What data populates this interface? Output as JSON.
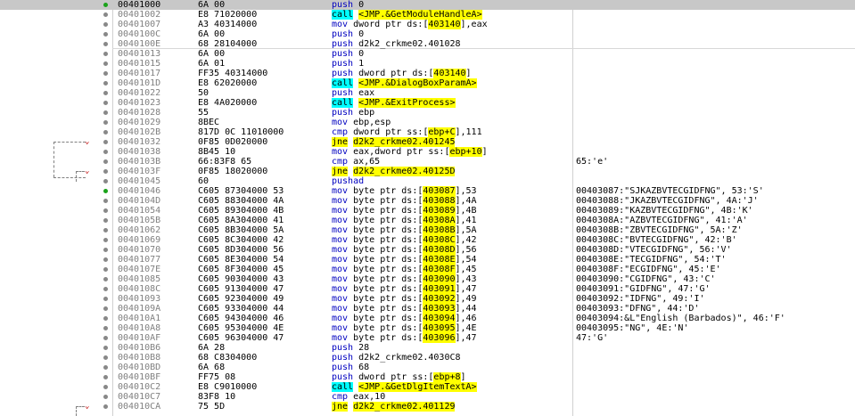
{
  "rows": [
    {
      "addr": "00401000",
      "bytes": "6A 00",
      "mnem": "push",
      "ops": "0",
      "opkind": "num",
      "comment": "",
      "sel": true,
      "bp": true
    },
    {
      "addr": "00401002",
      "bytes": "E8 71020000",
      "mnem": "call",
      "ops": "<JMP.&GetModuleHandleA>",
      "opkind": "call",
      "comment": ""
    },
    {
      "addr": "00401007",
      "bytes": "A3 40314000",
      "mnem": "mov",
      "ops": "dword ptr ds:[403140],eax",
      "opkind": "mem",
      "hl": "403140",
      "comment": ""
    },
    {
      "addr": "0040100C",
      "bytes": "6A 00",
      "mnem": "push",
      "ops": "0",
      "opkind": "num",
      "comment": ""
    },
    {
      "addr": "0040100E",
      "bytes": "68 28104000",
      "mnem": "push",
      "ops": "d2k2_crkme02.401028",
      "opkind": "plain",
      "comment": ""
    },
    {
      "addr": "00401013",
      "bytes": "6A 00",
      "mnem": "push",
      "ops": "0",
      "opkind": "num",
      "comment": ""
    },
    {
      "addr": "00401015",
      "bytes": "6A 01",
      "mnem": "push",
      "ops": "1",
      "opkind": "num",
      "comment": ""
    },
    {
      "addr": "00401017",
      "bytes": "FF35 40314000",
      "mnem": "push",
      "ops": "dword ptr ds:[403140]",
      "opkind": "mem",
      "hl": "403140",
      "comment": ""
    },
    {
      "addr": "0040101D",
      "bytes": "E8 62020000",
      "mnem": "call",
      "ops": "<JMP.&DialogBoxParamA>",
      "opkind": "call",
      "comment": ""
    },
    {
      "addr": "00401022",
      "bytes": "50",
      "mnem": "push",
      "ops": "eax",
      "opkind": "plain",
      "comment": ""
    },
    {
      "addr": "00401023",
      "bytes": "E8 4A020000",
      "mnem": "call",
      "ops": "<JMP.&ExitProcess>",
      "opkind": "call",
      "comment": ""
    },
    {
      "addr": "00401028",
      "bytes": "55",
      "mnem": "push",
      "ops": "ebp",
      "opkind": "plain",
      "comment": ""
    },
    {
      "addr": "00401029",
      "bytes": "8BEC",
      "mnem": "mov",
      "ops": "ebp,esp",
      "opkind": "plain",
      "comment": ""
    },
    {
      "addr": "0040102B",
      "bytes": "817D 0C 11010000",
      "mnem": "cmp",
      "ops": "dword ptr ss:[ebp+C],111",
      "opkind": "mem",
      "hl": "ebp+C",
      "comment": ""
    },
    {
      "addr": "00401032",
      "bytes": "0F85 0D020000",
      "mnem": "jne",
      "ops": "d2k2_crkme02.401245",
      "opkind": "jmp",
      "comment": "",
      "arrow": true
    },
    {
      "addr": "00401038",
      "bytes": "8B45 10",
      "mnem": "mov",
      "ops": "eax,dword ptr ss:[ebp+10]",
      "opkind": "mem",
      "hl": "ebp+10",
      "comment": ""
    },
    {
      "addr": "0040103B",
      "bytes": "66:83F8 65",
      "mnem": "cmp",
      "ops": "ax,65",
      "opkind": "plain",
      "comment": "65:'e'"
    },
    {
      "addr": "0040103F",
      "bytes": "0F85 18020000",
      "mnem": "jne",
      "ops": "d2k2_crkme02.40125D",
      "opkind": "jmp",
      "comment": "",
      "arrow": true
    },
    {
      "addr": "00401045",
      "bytes": "60",
      "mnem": "pushad",
      "ops": "",
      "opkind": "plain",
      "comment": ""
    },
    {
      "addr": "00401046",
      "bytes": "C605 87304000 53",
      "mnem": "mov",
      "ops": "byte ptr ds:[403087],53",
      "opkind": "mem",
      "hl": "403087",
      "comment": "00403087:\"SJKAZBVTECGIDFNG\", 53:'S'",
      "bp": true
    },
    {
      "addr": "0040104D",
      "bytes": "C605 88304000 4A",
      "mnem": "mov",
      "ops": "byte ptr ds:[403088],4A",
      "opkind": "mem",
      "hl": "403088",
      "comment": "00403088:\"JKAZBVTECGIDFNG\", 4A:'J'"
    },
    {
      "addr": "00401054",
      "bytes": "C605 89304000 4B",
      "mnem": "mov",
      "ops": "byte ptr ds:[403089],4B",
      "opkind": "mem",
      "hl": "403089",
      "comment": "00403089:\"KAZBVTECGIDFNG\", 4B:'K'"
    },
    {
      "addr": "0040105B",
      "bytes": "C605 8A304000 41",
      "mnem": "mov",
      "ops": "byte ptr ds:[40308A],41",
      "opkind": "mem",
      "hl": "40308A",
      "comment": "0040308A:\"AZBVTECGIDFNG\", 41:'A'"
    },
    {
      "addr": "00401062",
      "bytes": "C605 8B304000 5A",
      "mnem": "mov",
      "ops": "byte ptr ds:[40308B],5A",
      "opkind": "mem",
      "hl": "40308B",
      "comment": "0040308B:\"ZBVTECGIDFNG\", 5A:'Z'"
    },
    {
      "addr": "00401069",
      "bytes": "C605 8C304000 42",
      "mnem": "mov",
      "ops": "byte ptr ds:[40308C],42",
      "opkind": "mem",
      "hl": "40308C",
      "comment": "0040308C:\"BVTECGIDFNG\", 42:'B'"
    },
    {
      "addr": "00401070",
      "bytes": "C605 8D304000 56",
      "mnem": "mov",
      "ops": "byte ptr ds:[40308D],56",
      "opkind": "mem",
      "hl": "40308D",
      "comment": "0040308D:\"VTECGIDFNG\", 56:'V'"
    },
    {
      "addr": "00401077",
      "bytes": "C605 8E304000 54",
      "mnem": "mov",
      "ops": "byte ptr ds:[40308E],54",
      "opkind": "mem",
      "hl": "40308E",
      "comment": "0040308E:\"TECGIDFNG\", 54:'T'"
    },
    {
      "addr": "0040107E",
      "bytes": "C605 8F304000 45",
      "mnem": "mov",
      "ops": "byte ptr ds:[40308F],45",
      "opkind": "mem",
      "hl": "40308F",
      "comment": "0040308F:\"ECGIDFNG\", 45:'E'"
    },
    {
      "addr": "00401085",
      "bytes": "C605 90304000 43",
      "mnem": "mov",
      "ops": "byte ptr ds:[403090],43",
      "opkind": "mem",
      "hl": "403090",
      "comment": "00403090:\"CGIDFNG\", 43:'C'"
    },
    {
      "addr": "0040108C",
      "bytes": "C605 91304000 47",
      "mnem": "mov",
      "ops": "byte ptr ds:[403091],47",
      "opkind": "mem",
      "hl": "403091",
      "comment": "00403091:\"GIDFNG\", 47:'G'"
    },
    {
      "addr": "00401093",
      "bytes": "C605 92304000 49",
      "mnem": "mov",
      "ops": "byte ptr ds:[403092],49",
      "opkind": "mem",
      "hl": "403092",
      "comment": "00403092:\"IDFNG\", 49:'I'"
    },
    {
      "addr": "0040109A",
      "bytes": "C605 93304000 44",
      "mnem": "mov",
      "ops": "byte ptr ds:[403093],44",
      "opkind": "mem",
      "hl": "403093",
      "comment": "00403093:\"DFNG\", 44:'D'"
    },
    {
      "addr": "004010A1",
      "bytes": "C605 94304000 46",
      "mnem": "mov",
      "ops": "byte ptr ds:[403094],46",
      "opkind": "mem",
      "hl": "403094",
      "comment": "00403094:&L\"English (Barbados)\", 46:'F'"
    },
    {
      "addr": "004010A8",
      "bytes": "C605 95304000 4E",
      "mnem": "mov",
      "ops": "byte ptr ds:[403095],4E",
      "opkind": "mem",
      "hl": "403095",
      "comment": "00403095:\"NG\", 4E:'N'"
    },
    {
      "addr": "004010AF",
      "bytes": "C605 96304000 47",
      "mnem": "mov",
      "ops": "byte ptr ds:[403096],47",
      "opkind": "mem",
      "hl": "403096",
      "comment": "47:'G'"
    },
    {
      "addr": "004010B6",
      "bytes": "6A 28",
      "mnem": "push",
      "ops": "28",
      "opkind": "num",
      "comment": ""
    },
    {
      "addr": "004010B8",
      "bytes": "68 C8304000",
      "mnem": "push",
      "ops": "d2k2_crkme02.4030C8",
      "opkind": "plain",
      "comment": ""
    },
    {
      "addr": "004010BD",
      "bytes": "6A 68",
      "mnem": "push",
      "ops": "68",
      "opkind": "num",
      "comment": ""
    },
    {
      "addr": "004010BF",
      "bytes": "FF75 08",
      "mnem": "push",
      "ops": "dword ptr ss:[ebp+8]",
      "opkind": "mem",
      "hl": "ebp+8",
      "comment": ""
    },
    {
      "addr": "004010C2",
      "bytes": "E8 C9010000",
      "mnem": "call",
      "ops": "<JMP.&GetDlgItemTextA>",
      "opkind": "call",
      "comment": ""
    },
    {
      "addr": "004010C7",
      "bytes": "83F8 10",
      "mnem": "cmp",
      "ops": "eax,10",
      "opkind": "plain",
      "comment": ""
    },
    {
      "addr": "004010CA",
      "bytes": "75 5D",
      "mnem": "jne",
      "ops": "d2k2_crkme02.401129",
      "opkind": "jmp",
      "comment": "",
      "arrow": true
    }
  ],
  "colors": {
    "selected_row": "#c8c8c8",
    "call_highlight": "#00ffff",
    "jump_highlight": "#ffff00",
    "address_text": "#808080",
    "breakpoint_dot": "#1aa31a",
    "mnemonic": "#0000c0",
    "branch_arrow": "#c00000"
  },
  "arrow_glyph": "⌄"
}
